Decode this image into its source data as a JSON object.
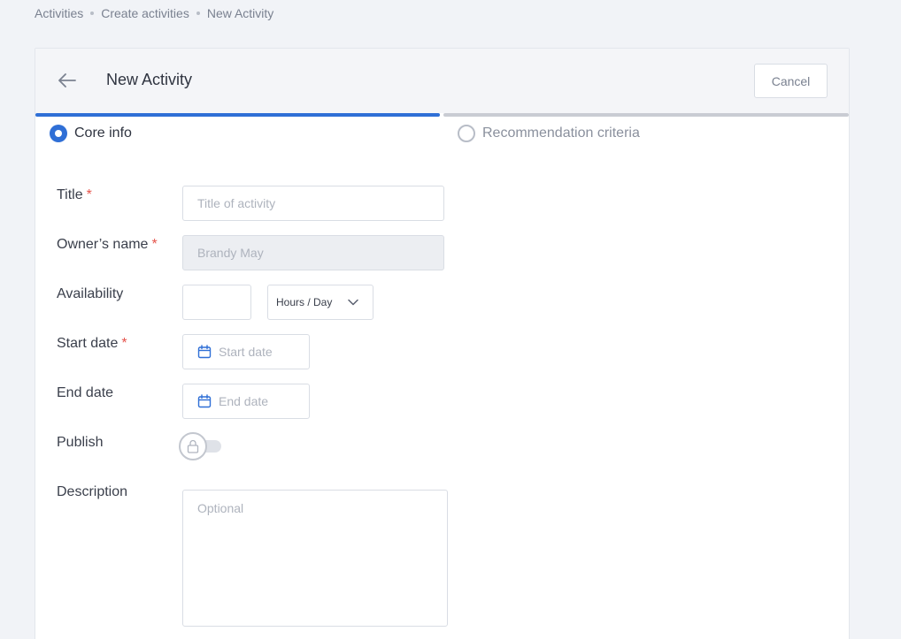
{
  "breadcrumb": {
    "items": [
      "Activities",
      "Create activities",
      "New Activity"
    ]
  },
  "header": {
    "title": "New Activity",
    "cancel_label": "Cancel",
    "back_icon": "arrow-left-icon"
  },
  "steps": [
    {
      "label": "Core info",
      "active": true
    },
    {
      "label": "Recommendation criteria",
      "active": false
    }
  ],
  "form": {
    "title": {
      "label": "Title",
      "required": "*",
      "placeholder": "Title of activity",
      "value": ""
    },
    "owner": {
      "label": "Owner’s name",
      "required": "*",
      "value": "Brandy May"
    },
    "availability": {
      "label": "Availability",
      "value": "",
      "unit": "Hours / Day"
    },
    "start_date": {
      "label": "Start date",
      "required": "*",
      "placeholder": "Start date"
    },
    "end_date": {
      "label": "End date",
      "placeholder": "End date"
    },
    "publish": {
      "label": "Publish",
      "enabled": false,
      "icon": "lock-icon"
    },
    "description": {
      "label": "Description",
      "placeholder": "Optional",
      "value": ""
    }
  },
  "colors": {
    "accent": "#2f6fd6",
    "required": "#e5534b",
    "background": "#f1f3f7"
  }
}
